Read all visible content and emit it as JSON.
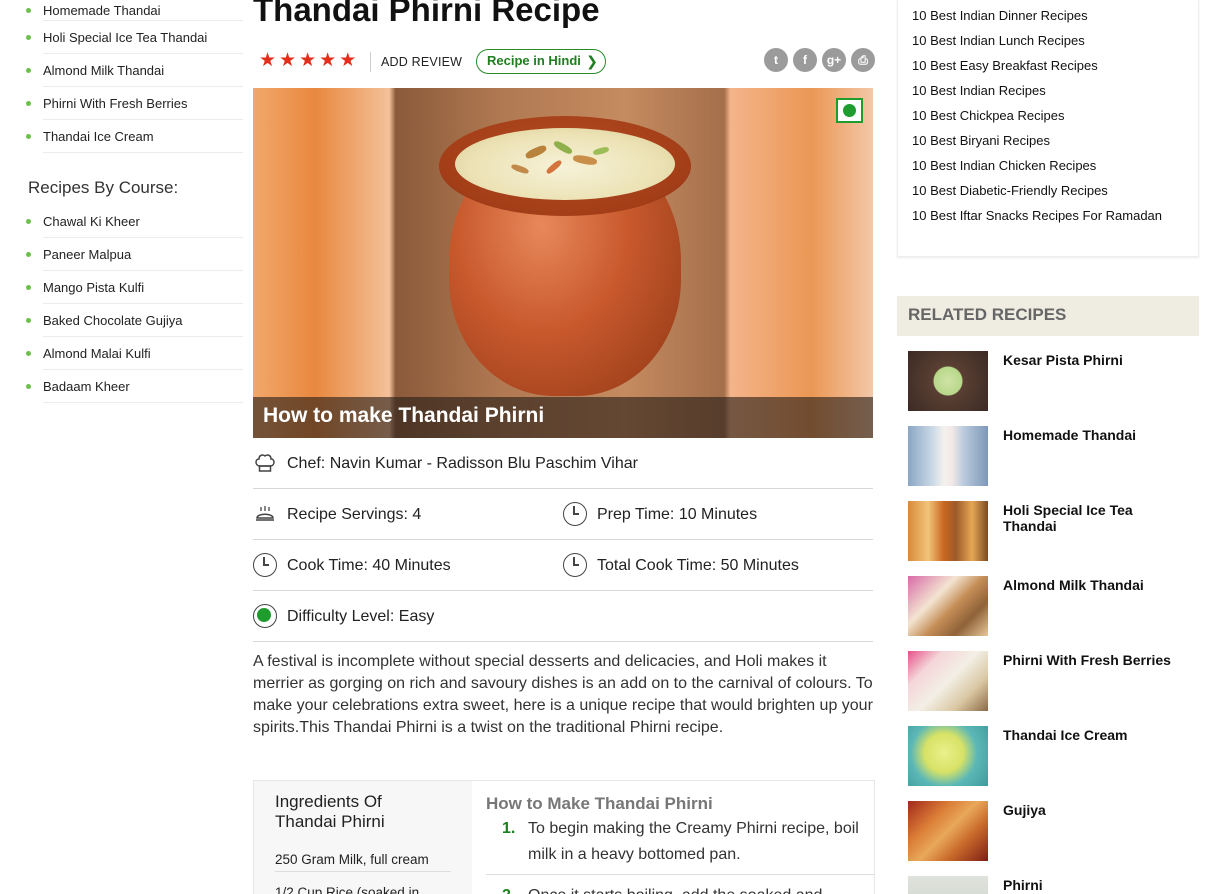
{
  "left_sidebar": {
    "group_a": [
      "Homemade Thandai",
      "Holi Special Ice Tea Thandai",
      "Almond Milk Thandai",
      "Phirni With Fresh Berries",
      "Thandai Ice Cream"
    ],
    "course_heading": "Recipes By Course:",
    "group_b": [
      "Chawal Ki Kheer",
      "Paneer Malpua",
      "Mango Pista Kulfi",
      "Baked Chocolate Gujiya",
      "Almond Malai Kulfi",
      "Badaam Kheer"
    ]
  },
  "recipe": {
    "title": "Thandai Phirni Recipe",
    "rating_stars": 5,
    "add_review": "ADD REVIEW",
    "hindi_button": "Recipe in Hindi",
    "hindi_chevron": "❯",
    "share_icons": [
      "twitter-icon",
      "facebook-icon",
      "google-plus-icon",
      "print-icon"
    ],
    "hero_caption": "How to make Thandai Phirni",
    "chef_label": "Chef:",
    "chef_value": "Navin Kumar - Radisson Blu Paschim Vihar",
    "servings_label": "Recipe Servings:",
    "servings_value": "4",
    "prep_label": "Prep Time:",
    "prep_value": "10 Minutes",
    "cook_label": "Cook Time:",
    "cook_value": "40 Minutes",
    "total_label": "Total Cook Time:",
    "total_value": "50 Minutes",
    "difficulty_label": "Difficulty Level:",
    "difficulty_value": "Easy",
    "description": "A festival is incomplete without special desserts and delicacies, and Holi makes it merrier as gorging on rich and savoury dishes is an add on to the carnival of colours. To make your celebrations extra sweet, here is a unique recipe that would brighten up your spirits.This Thandai Phirni is a twist on the traditional Phirni recipe."
  },
  "ingredients": {
    "heading": "Ingredients Of Thandai Phirni",
    "items": [
      "250 Gram Milk, full cream",
      "1/2 Cup Rice (soaked in"
    ]
  },
  "steps": {
    "heading": "How to Make Thandai Phirni",
    "items": [
      {
        "num": "1.",
        "text": "To begin making the Creamy Phirni recipe, boil milk in a heavy bottomed pan."
      },
      {
        "num": "2.",
        "text": "Once it starts boiling, add the soaked and"
      }
    ]
  },
  "right_sidebar": {
    "best_list": [
      "10 Best Indian Dinner Recipes",
      "10 Best Indian Lunch Recipes",
      "10 Best Easy Breakfast Recipes",
      "10 Best Indian Recipes",
      "10 Best Chickpea Recipes",
      "10 Best Biryani Recipes",
      "10 Best Indian Chicken Recipes",
      "10 Best Diabetic-Friendly Recipes",
      "10 Best Iftar Snacks Recipes For Ramadan"
    ],
    "related_heading": "RELATED RECIPES",
    "related": [
      "Kesar Pista Phirni",
      "Homemade Thandai",
      "Holi Special Ice Tea Thandai",
      "Almond Milk Thandai",
      "Phirni With Fresh Berries",
      "Thandai Ice Cream",
      "Gujiya",
      "Phirni"
    ]
  },
  "colors": {
    "accent_green": "#1f7e1f",
    "star_red": "#e52d1b",
    "bullet_green": "#6cc04a",
    "related_head_bg": "#efece2"
  }
}
